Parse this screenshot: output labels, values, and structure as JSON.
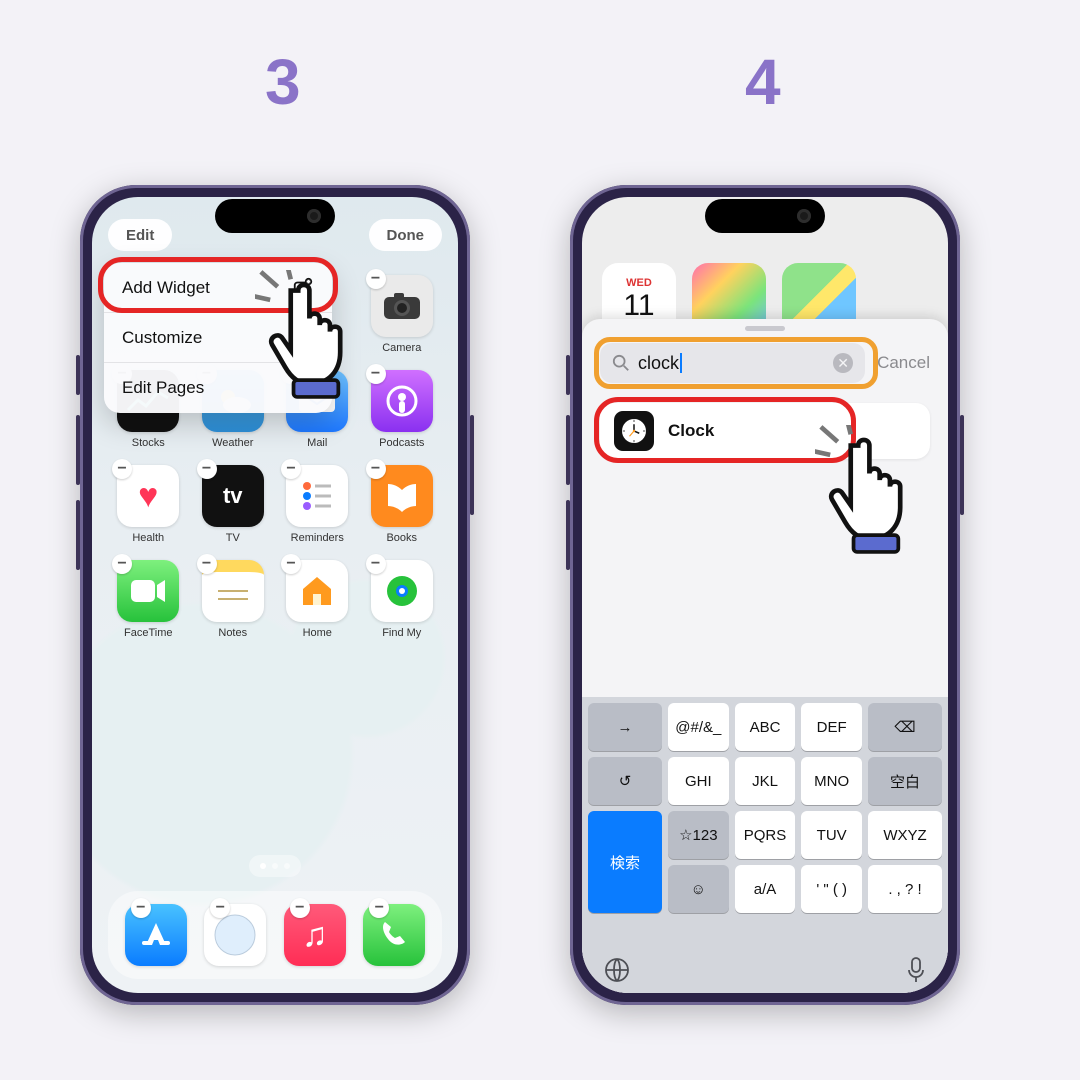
{
  "steps": {
    "s3": "3",
    "s4": "4"
  },
  "screen3": {
    "pills": {
      "edit": "Edit",
      "done": "Done"
    },
    "menu": {
      "add": "Add Widget",
      "customize": "Customize",
      "pages": "Edit Pages"
    },
    "apps_row1": [
      {
        "name": "Camera",
        "bg": "#eaeaea",
        "glyph": "📷"
      }
    ],
    "apps_row2": [
      {
        "name": "Stocks",
        "bg": "#111",
        "glyph": "📈",
        "gcol": "#6fe0c4"
      },
      {
        "name": "Weather",
        "bg": "#3aa7e8",
        "glyph": "☀️"
      },
      {
        "name": "Mail",
        "bg": "linear-gradient(#6fc3ff,#1e78ff)",
        "glyph": "✉️",
        "gcol": "#fff"
      },
      {
        "name": "Podcasts",
        "bg": "linear-gradient(#d070ff,#8a30f0)",
        "glyph": "⦾",
        "gcol": "#fff"
      }
    ],
    "apps_row3": [
      {
        "name": "Health",
        "bg": "#fff",
        "glyph": "♥",
        "gcol": "#ff3557"
      },
      {
        "name": "TV",
        "bg": "#111",
        "glyph": "tv",
        "badge": "tv"
      },
      {
        "name": "Reminders",
        "bg": "#fff",
        "glyph": "≔",
        "gcol": "#f0a030"
      },
      {
        "name": "Books",
        "bg": "#ff8a1e",
        "glyph": "▮▮",
        "gcol": "#fff"
      }
    ],
    "apps_row4": [
      {
        "name": "FaceTime",
        "bg": "linear-gradient(#7ef07e,#27c23b)",
        "glyph": "■",
        "gcol": "#fff"
      },
      {
        "name": "Notes",
        "bg": "#fff",
        "glyph": "≣",
        "gcol": "#c8a840"
      },
      {
        "name": "Home",
        "bg": "#fff",
        "glyph": "⌂",
        "gcol": "#ff9a1e"
      },
      {
        "name": "Find My",
        "bg": "#fff",
        "glyph": "◎",
        "gcol": "#27c23b"
      }
    ],
    "dock": [
      {
        "name": "App Store",
        "bg": "linear-gradient(#49c2ff,#0a7cff)",
        "glyph": "A",
        "gcol": "#fff"
      },
      {
        "name": "Safari",
        "bg": "#fff",
        "glyph": "✦",
        "compass": true
      },
      {
        "name": "Music",
        "bg": "linear-gradient(#ff5a7a,#ff2d55)",
        "glyph": "♫",
        "gcol": "#fff"
      },
      {
        "name": "Phone",
        "bg": "linear-gradient(#7ef07e,#27c23b)",
        "glyph": "✆",
        "gcol": "#fff"
      }
    ]
  },
  "screen4": {
    "calendar": {
      "dow": "WED",
      "day": "11"
    },
    "search": {
      "query": "clock",
      "cancel": "Cancel"
    },
    "result": {
      "name": "Clock"
    },
    "keys": {
      "r1": [
        "→",
        "@#/&_",
        "ABC",
        "DEF",
        "⌫"
      ],
      "r2": [
        "↺",
        "GHI",
        "JKL",
        "MNO",
        "空白"
      ],
      "r3": [
        "☆123",
        "PQRS",
        "TUV",
        "WXYZ",
        "検索"
      ],
      "r4": [
        "☺",
        "a/A",
        "' \" ( )",
        ". , ? !",
        ""
      ]
    }
  }
}
